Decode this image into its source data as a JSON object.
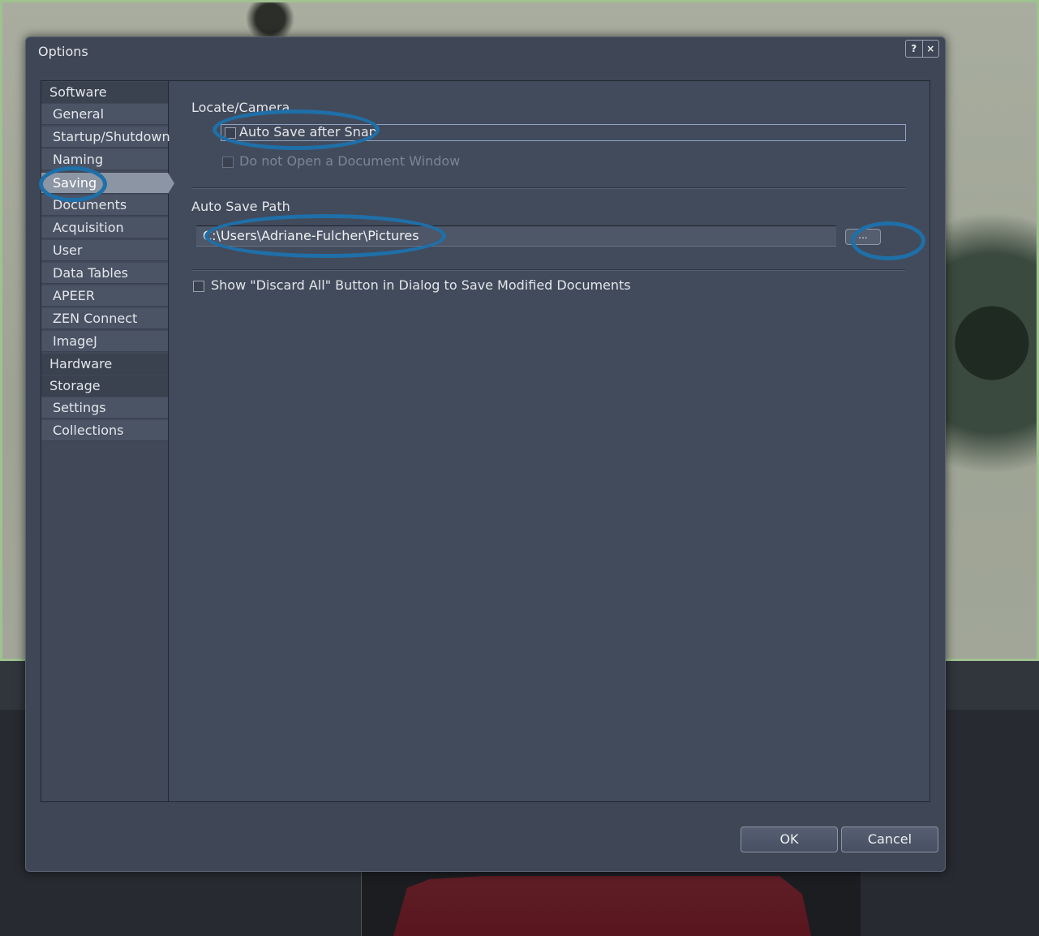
{
  "window": {
    "title": "Options",
    "help_label": "?",
    "close_label": "×"
  },
  "sidebar": {
    "items": [
      {
        "label": "Software",
        "kind": "header"
      },
      {
        "label": "General",
        "kind": "sub"
      },
      {
        "label": "Startup/Shutdown",
        "kind": "sub"
      },
      {
        "label": "Naming",
        "kind": "sub"
      },
      {
        "label": "Saving",
        "kind": "sub",
        "selected": true
      },
      {
        "label": "Documents",
        "kind": "sub"
      },
      {
        "label": "Acquisition",
        "kind": "sub"
      },
      {
        "label": "User",
        "kind": "sub"
      },
      {
        "label": "Data Tables",
        "kind": "sub"
      },
      {
        "label": "APEER",
        "kind": "sub"
      },
      {
        "label": "ZEN Connect",
        "kind": "sub"
      },
      {
        "label": "ImageJ",
        "kind": "sub"
      },
      {
        "label": "Hardware",
        "kind": "header"
      },
      {
        "label": "Storage",
        "kind": "header"
      },
      {
        "label": "Settings",
        "kind": "sub"
      },
      {
        "label": "Collections",
        "kind": "sub"
      }
    ]
  },
  "main": {
    "locate_camera": {
      "label": "Locate/Camera",
      "auto_save_label": "Auto Save after Snap",
      "auto_save_checked": false,
      "no_document_label": "Do not Open a Document Window",
      "no_document_checked": false
    },
    "auto_save_path": {
      "label": "Auto Save Path",
      "value": "C:\\Users\\Adriane-Fulcher\\Pictures",
      "browse_label": "..."
    },
    "discard_all": {
      "label": "Show \"Discard All\" Button in Dialog to Save Modified Documents",
      "checked": false
    }
  },
  "footer": {
    "ok_label": "OK",
    "cancel_label": "Cancel"
  },
  "colors": {
    "annotation_ring": "#1f6fa8",
    "dialog_bg": "#3f4756",
    "selected_item": "#8c95a3"
  }
}
